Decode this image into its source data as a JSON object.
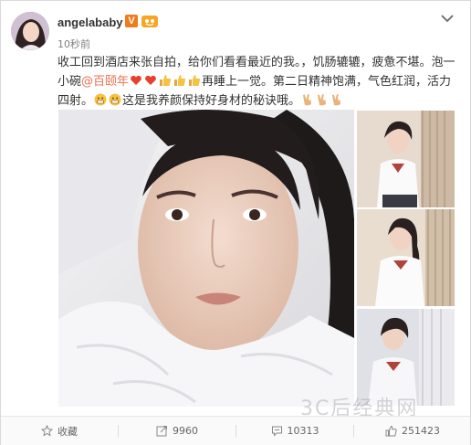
{
  "post": {
    "username": "angelababy",
    "verified_badge": "V",
    "timestamp": "10秒前",
    "text_part1": "收工回到酒店来张自拍，给你们看看最近的我。，饥肠辘辘，疲惫不堪。泡一小碗",
    "mention": "@百颐年",
    "text_part2": "再睡上一觉。第二日精神饱满，气色红润，活力四射。",
    "text_part3": "这是我养颜保持好身材的秘诀哦。"
  },
  "icons": {
    "more": "chevron-down-icon",
    "favorite": "star-icon",
    "share": "share-icon",
    "comment": "comment-icon",
    "like": "thumbs-up-icon"
  },
  "actions": {
    "favorite_label": "收藏",
    "share_count": "9960",
    "comment_count": "10313",
    "like_count": "251423"
  },
  "watermark": "3C后经典网",
  "colors": {
    "mention": "#eb7350",
    "vip_badge": "#f07b1d",
    "emoji_heart": "#e8402c",
    "emoji_yellow": "#f5c242"
  }
}
